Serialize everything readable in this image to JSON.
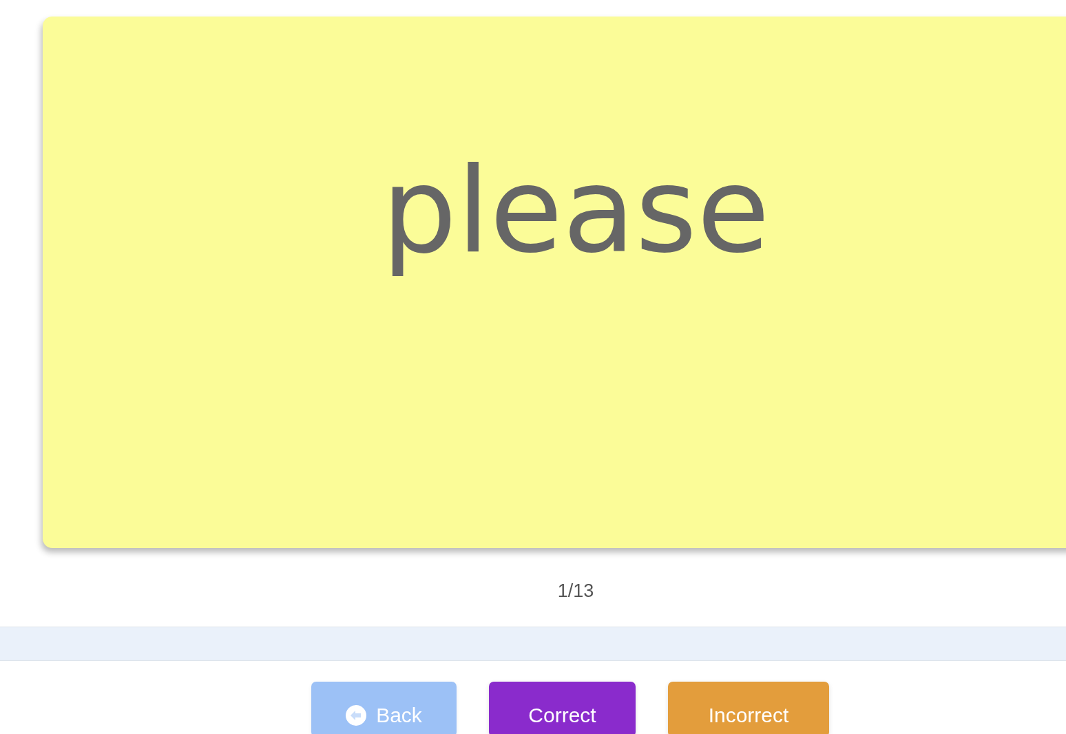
{
  "card": {
    "word": "please"
  },
  "counter": "1/13",
  "buttons": [
    {
      "label": "Back",
      "kind": "back",
      "disabled": true
    },
    {
      "label": "Correct",
      "kind": "correct",
      "disabled": false
    },
    {
      "label": "Incorrect",
      "kind": "incorrect",
      "disabled": false
    }
  ]
}
